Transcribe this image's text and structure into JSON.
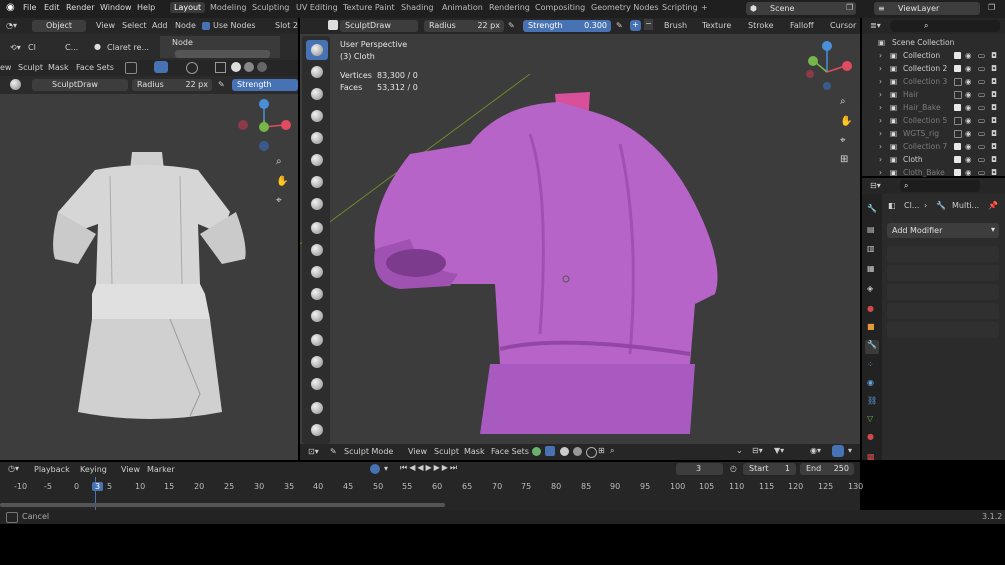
{
  "topbar": {
    "menus": [
      "File",
      "Edit",
      "Render",
      "Window",
      "Help"
    ],
    "tabs": [
      "Layout",
      "Modeling",
      "Sculpting",
      "UV Editing",
      "Texture Paint",
      "Shading",
      "Animation",
      "Rendering",
      "Compositing",
      "Geometry Nodes",
      "Scripting"
    ],
    "add_tab": "+",
    "scene": "Scene",
    "view_layer": "ViewLayer"
  },
  "left_editor": {
    "mode": "Object",
    "menus": [
      "View",
      "Select",
      "Add",
      "Node"
    ],
    "use_nodes": "Use Nodes",
    "slot": "Slot 2",
    "node_panel": "Node",
    "obj_short": "Cl",
    "mat_short": "C...",
    "material": "Claret re..."
  },
  "left_sculpt": {
    "menus": [
      "ew",
      "Sculpt",
      "Mask",
      "Face Sets"
    ],
    "brush": "SculptDraw",
    "radius_label": "Radius",
    "radius_value": "22 px",
    "strength_label": "Strength"
  },
  "viewport": {
    "brush": "SculptDraw",
    "radius_label": "Radius",
    "radius_value": "22 px",
    "strength_label": "Strength",
    "strength_value": "0.300",
    "header_menus": [
      "Brush",
      "Texture",
      "Stroke",
      "Falloff",
      "Cursor"
    ],
    "perspective": "User Perspective",
    "object": "(3) Cloth",
    "vertices_label": "Vertices",
    "vertices_value": "83,300 / 0",
    "faces_label": "Faces",
    "faces_value": "53,312 / 0",
    "mode": "Sculpt Mode",
    "bottom_menus": [
      "View",
      "Sculpt",
      "Mask",
      "Face Sets"
    ]
  },
  "outliner": {
    "root": "Scene Collection",
    "items": [
      {
        "name": "Collection",
        "dim": false,
        "checked": true
      },
      {
        "name": "Collection 2",
        "dim": false,
        "checked": true
      },
      {
        "name": "Collection 3",
        "dim": true,
        "checked": false
      },
      {
        "name": "Hair",
        "dim": true,
        "checked": false
      },
      {
        "name": "Hair_Bake",
        "dim": true,
        "checked": true
      },
      {
        "name": "Collection 5",
        "dim": true,
        "checked": false
      },
      {
        "name": "WGTS_rig",
        "dim": true,
        "checked": false
      },
      {
        "name": "Collection 7",
        "dim": true,
        "checked": true
      },
      {
        "name": "Cloth",
        "dim": false,
        "checked": true
      },
      {
        "name": "Cloth_Bake",
        "dim": true,
        "checked": true
      }
    ]
  },
  "properties": {
    "obj_short": "Cl...",
    "modifier_short": "Multi...",
    "add_modifier": "Add Modifier"
  },
  "timeline": {
    "menus": [
      "Playback",
      "Keying",
      "View",
      "Marker"
    ],
    "current_frame": "3",
    "start_label": "Start",
    "start_value": "1",
    "end_label": "End",
    "end_value": "250",
    "ticks": [
      "-10",
      "-5",
      "0",
      "3",
      "5",
      "10",
      "15",
      "20",
      "25",
      "30",
      "35",
      "40",
      "45",
      "50",
      "55",
      "60",
      "65",
      "70",
      "75",
      "80",
      "85",
      "90",
      "95",
      "100",
      "105",
      "110",
      "115",
      "120",
      "125",
      "130"
    ]
  },
  "status": {
    "left": "Cancel",
    "version": "3.1.2"
  },
  "colors": {
    "accent": "#4772b3",
    "cloth": "#b764c8",
    "header": "#262626",
    "panel": "#2b2b2b"
  }
}
